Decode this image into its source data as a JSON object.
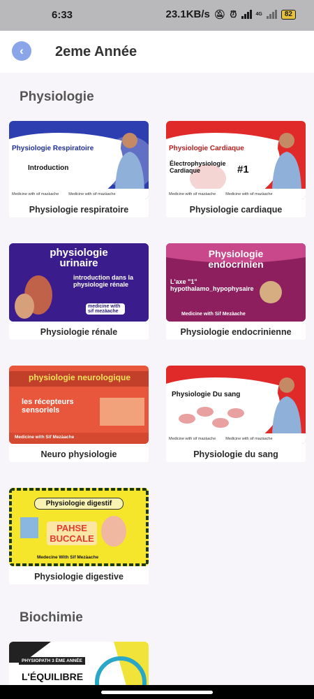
{
  "status": {
    "time": "6:33",
    "speed": "23.1KB/s",
    "network": "4G",
    "battery": "82"
  },
  "header": {
    "title": "2eme Année"
  },
  "sections": [
    {
      "title": "Physiologie"
    },
    {
      "title": "Biochimie"
    }
  ],
  "cards": [
    {
      "label": "Physiologie respiratoire",
      "thumb_title": "Physiologie Respiratoire",
      "thumb_sub": "Introduction",
      "channel": "Medicine with sif mazàache"
    },
    {
      "label": "Physiologie cardiaque",
      "thumb_title": "Physiologie Cardiaque",
      "thumb_sub": "Électrophysiologie Cardiaque",
      "thumb_num": "#1",
      "channel": "Medicine with sif mazàache"
    },
    {
      "label": "Physiologie rénale",
      "thumb_title": "physiologie urinaire",
      "thumb_sub": "introduction dans la physiologie rénale",
      "channel": "medicine with sif mezàache"
    },
    {
      "label": "Physiologie endocrinienne",
      "thumb_title": "Physiologie endocrinien",
      "thumb_sub": "L'axe \"1\" hypothalamo_hypophysaire",
      "channel": "Medicine with Sif Mezàache"
    },
    {
      "label": "Neuro physiologie",
      "thumb_title": "physiologie neurologique",
      "thumb_sub": "les récepteurs sensoriels",
      "channel": "Medicine with Sif Mezàache"
    },
    {
      "label": "Physiologie du sang",
      "thumb_title": "Physiologie Du sang",
      "channel": "Medicine with sif mazàache"
    },
    {
      "label": "Physiologie digestive",
      "thumb_title": "Physiologie digestif",
      "thumb_sub": "PAHSE BUCCALE",
      "channel": "Medecine With Sif Mezàache"
    },
    {
      "thumb_title": "PHYSIOPATH 3 ÈME ANNÉE",
      "thumb_sub": "L'ÉQUILIBRE"
    }
  ]
}
